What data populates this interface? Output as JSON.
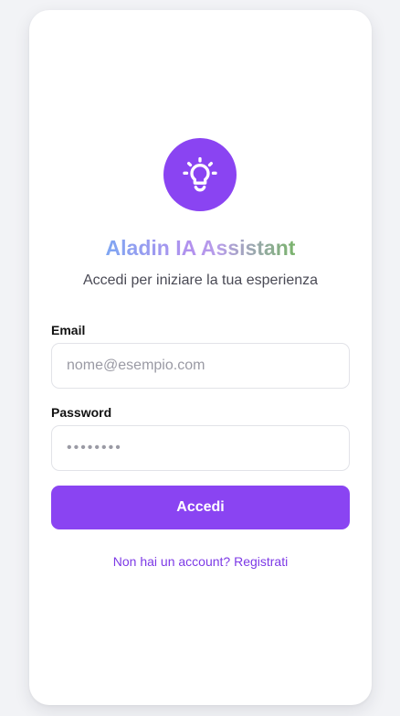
{
  "app": {
    "title": "Aladin IA Assistant",
    "subtitle": "Accedi per iniziare la tua esperienza",
    "logo_icon": "lightbulb-icon"
  },
  "form": {
    "email_label": "Email",
    "email_placeholder": "nome@esempio.com",
    "email_value": "",
    "password_label": "Password",
    "password_placeholder": "••••••••",
    "password_value": "",
    "submit_label": "Accedi"
  },
  "footer": {
    "register_link": "Non hai un account? Registrati"
  },
  "colors": {
    "accent": "#8a44f2",
    "link": "#7d3ae6",
    "background": "#f2f3f6",
    "card": "#ffffff"
  }
}
